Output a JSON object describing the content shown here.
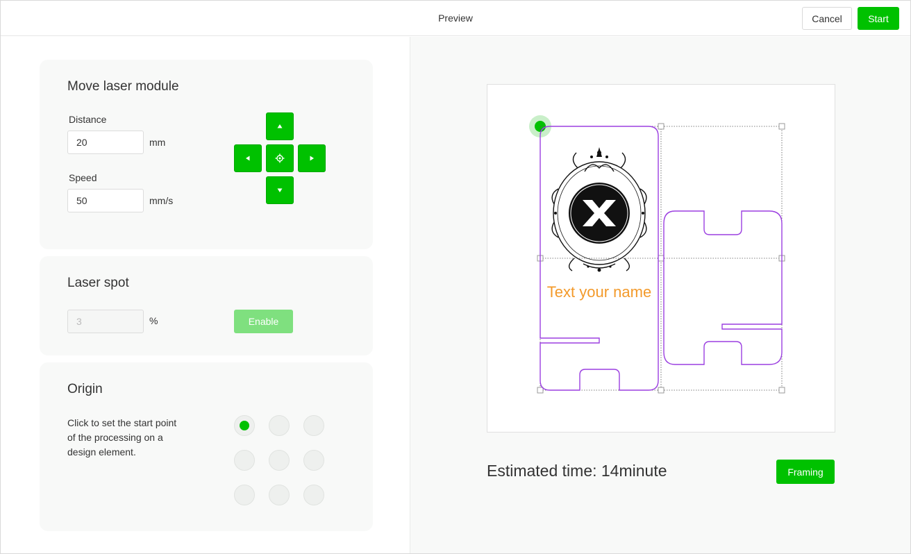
{
  "header": {
    "title": "Preview",
    "cancel_label": "Cancel",
    "start_label": "Start"
  },
  "move_module": {
    "title": "Move laser module",
    "distance_label": "Distance",
    "distance_value": "20",
    "distance_unit": "mm",
    "speed_label": "Speed",
    "speed_value": "50",
    "speed_unit": "mm/s"
  },
  "laser_spot": {
    "title": "Laser spot",
    "value": "3",
    "unit": "%",
    "enable_label": "Enable"
  },
  "origin": {
    "title": "Origin",
    "description": "Click to set the start point of the processing on a design element.",
    "selected_index": 0
  },
  "preview": {
    "design_text": "Text your name",
    "design_text_color": "#f39a2b",
    "path_color": "#9b3fe0",
    "estimated_time": "Estimated time: 14minute",
    "framing_label": "Framing"
  },
  "colors": {
    "accent": "#00c100",
    "accent_disabled": "#7fe07f"
  }
}
